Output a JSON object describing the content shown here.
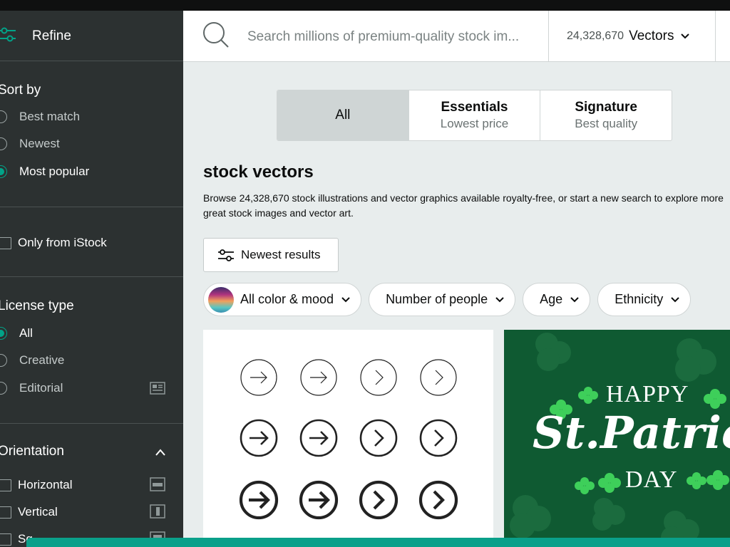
{
  "sidebar": {
    "refine_label": "Refine",
    "sort": {
      "title": "Sort by",
      "options": [
        {
          "label": "Best match",
          "selected": false
        },
        {
          "label": "Newest",
          "selected": false
        },
        {
          "label": "Most popular",
          "selected": true
        }
      ]
    },
    "only_istock": {
      "label": "Only from iStock",
      "checked": false
    },
    "license": {
      "title": "License type",
      "options": [
        {
          "label": "All",
          "selected": true
        },
        {
          "label": "Creative",
          "selected": false
        },
        {
          "label": "Editorial",
          "selected": false
        }
      ]
    },
    "orientation": {
      "title": "Orientation",
      "options": [
        {
          "label": "Horizontal",
          "checked": false
        },
        {
          "label": "Vertical",
          "checked": false
        },
        {
          "label": "Sq",
          "checked": false
        }
      ]
    }
  },
  "header": {
    "search_placeholder": "Search millions of premium-quality stock im...",
    "count": "24,328,670",
    "asset_type": "Vectors"
  },
  "tiers": [
    {
      "name": "All",
      "sub": "",
      "active": true
    },
    {
      "name": "Essentials",
      "sub": "Lowest price",
      "active": false
    },
    {
      "name": "Signature",
      "sub": "Best quality",
      "active": false
    }
  ],
  "main": {
    "title": "stock vectors",
    "description": "Browse 24,328,670 stock illustrations and vector graphics available royalty-free, or start a new search to explore more great stock images and vector art.",
    "newest_button": "Newest results",
    "filters": {
      "color": "All color & mood",
      "people": "Number of people",
      "age": "Age",
      "ethnicity": "Ethnicity"
    }
  },
  "results": {
    "image2": {
      "line1": "HAPPY",
      "line2": "St.Patrick's",
      "line3": "DAY"
    }
  },
  "colors": {
    "accent": "#02a388",
    "sidebar_bg": "#2c3131",
    "clover_green": "#0f5a32"
  }
}
